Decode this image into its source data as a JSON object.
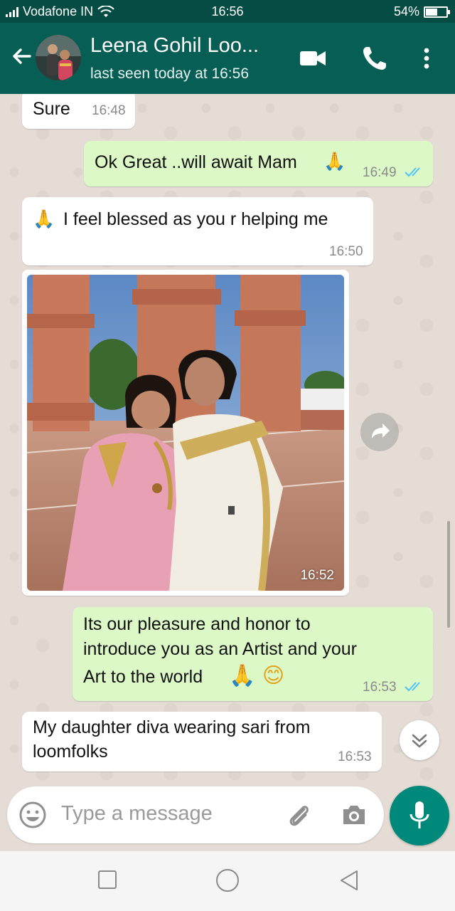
{
  "status_bar": {
    "carrier": "Vodafone IN",
    "time": "16:56",
    "battery": "54%",
    "battery_level": 0.54
  },
  "header": {
    "contact_name": "Leena Gohil Loo...",
    "last_seen": "last seen today at 16:56"
  },
  "messages": [
    {
      "direction": "incoming",
      "text": "Sure",
      "time": "16:48"
    },
    {
      "direction": "outgoing",
      "text": "Ok Great ..will await Mam",
      "emoji": "🙏",
      "time": "16:49",
      "status": "read"
    },
    {
      "direction": "incoming",
      "emoji": "🙏",
      "text": "I feel blessed as you r helping me",
      "time": "16:50"
    },
    {
      "direction": "incoming",
      "type": "image",
      "time": "16:52"
    },
    {
      "direction": "outgoing",
      "lines": [
        "Its our pleasure and honor to",
        "introduce you as an Artist and your",
        "Art to the world"
      ],
      "emoji": "🙏 😊",
      "time": "16:53",
      "status": "read"
    },
    {
      "direction": "incoming",
      "lines": [
        "My daughter diva wearing sari from",
        "loomfolks"
      ],
      "time": "16:53"
    }
  ],
  "composer": {
    "placeholder": "Type a message"
  },
  "colors": {
    "header": "#075e54",
    "status_bar": "#054d44",
    "outgoing_bubble": "#dcf8c6",
    "incoming_bubble": "#ffffff",
    "read_ticks": "#4fc3f7",
    "mic_button": "#00897b"
  },
  "icons": [
    "signal-icon",
    "wifi-icon",
    "battery-icon",
    "back-arrow-icon",
    "video-call-icon",
    "phone-icon",
    "more-vert-icon",
    "forward-icon",
    "scroll-down-icon",
    "emoji-icon",
    "attach-icon",
    "camera-icon",
    "mic-icon",
    "nav-recents-icon",
    "nav-home-icon",
    "nav-back-icon"
  ]
}
